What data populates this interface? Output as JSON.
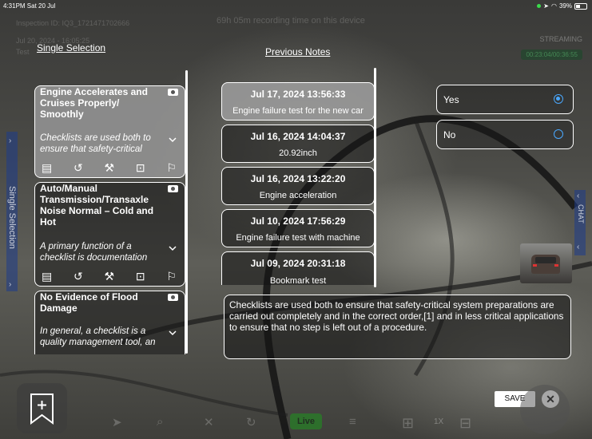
{
  "status_bar": {
    "time": "4:31PM  Sat 20 Jul",
    "battery": "39%"
  },
  "background": {
    "inspection_id": "Inspection ID: IQ3_1721471702666",
    "date_line": "Jul 20, 2024 - 16:05:25",
    "test_line": "Test",
    "recording_time": "69h 05m recording time on this device",
    "streaming": "STREAMING",
    "timer": "00:23:04/00:36:55"
  },
  "headers": {
    "single_selection": "Single Selection",
    "previous_notes": "Previous Notes"
  },
  "side_tabs": {
    "left": "Single Selection",
    "right": "CHAT"
  },
  "checklist": [
    {
      "title": "Engine Accelerates and Cruises Properly/ Smoothly",
      "description": "Checklists are used both to ensure that safety-critical",
      "selected": true
    },
    {
      "title": "Auto/Manual Transmission/Transaxle Noise Normal – Cold and Hot",
      "description": "A primary function of a checklist is documentation",
      "selected": false
    },
    {
      "title": "No Evidence of Flood Damage",
      "description": "In general, a checklist is a quality management tool, an",
      "selected": false
    }
  ],
  "notes": [
    {
      "date": "Jul 17, 2024 13:56:33",
      "text": "Engine failure test for the new car",
      "selected": true
    },
    {
      "date": "Jul 16, 2024 14:04:37",
      "text": "20.92inch",
      "selected": false
    },
    {
      "date": "Jul 16, 2024 13:22:20",
      "text": "Engine acceleration",
      "selected": false
    },
    {
      "date": "Jul 10, 2024 17:56:29",
      "text": "Engine failure test with machine",
      "selected": false
    },
    {
      "date": "Jul 09, 2024 20:31:18",
      "text": "Bookmark test",
      "selected": false
    }
  ],
  "options": [
    {
      "label": "Yes",
      "selected": true
    },
    {
      "label": "No",
      "selected": false
    }
  ],
  "note_text": "Checklists are used both to ensure that safety-critical system preparations are carried out completely and in the correct order,[1] and in less critical applications to ensure that no step is left out of a procedure.",
  "buttons": {
    "save": "SAVE",
    "close": "✕"
  },
  "toolbar": {
    "live": "Live",
    "zoom": "1X"
  }
}
